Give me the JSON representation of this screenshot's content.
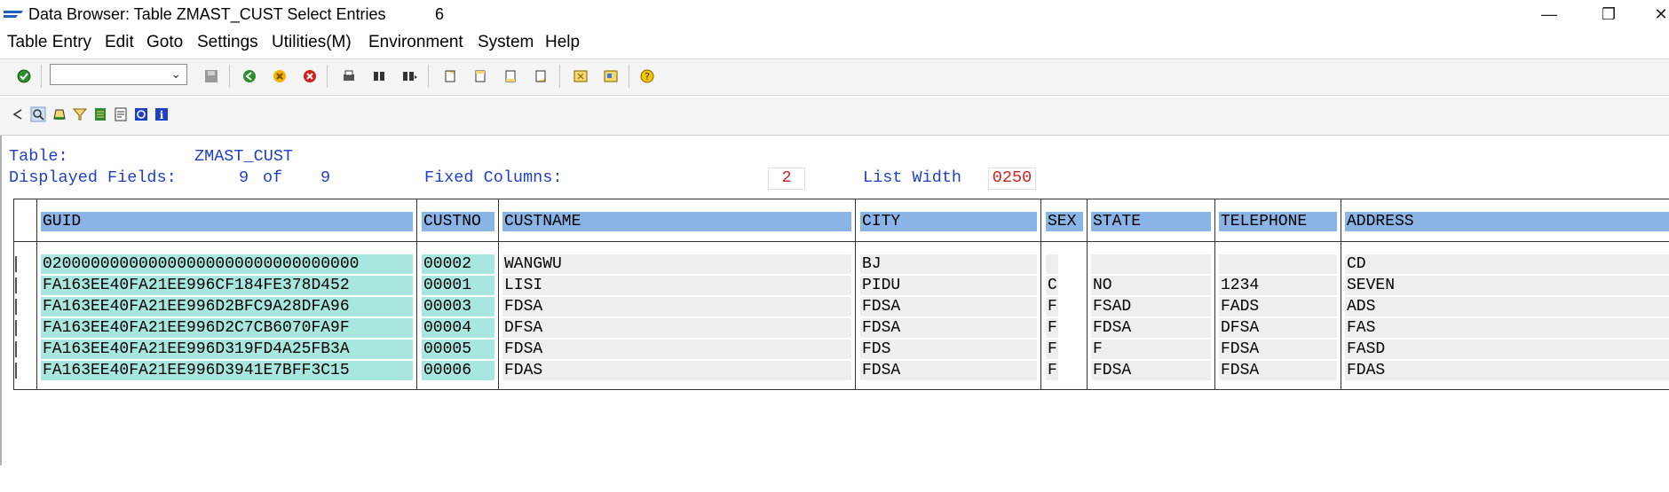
{
  "window": {
    "title": "Data Browser: Table ZMAST_CUST Select Entries",
    "count": "6",
    "minimize_icon": "minimize-icon",
    "restore_icon": "restore-icon",
    "close_icon": "close-icon"
  },
  "menu": [
    "Table Entry",
    "Edit",
    "Goto",
    "Settings",
    "Utilities(M)",
    "Environment",
    "System",
    "Help"
  ],
  "toolbar": {
    "command_value": "",
    "icons": [
      "enter-icon",
      "save-icon",
      "back-icon",
      "exit-icon",
      "cancel-icon",
      "print-icon",
      "find-icon",
      "find-next-icon",
      "first-page-icon",
      "previous-page-icon",
      "next-page-icon",
      "last-page-icon",
      "create-session-icon",
      "shortcut-icon",
      "help-icon"
    ],
    "app_icons": [
      "back-arrow-icon",
      "details-icon",
      "print-list-icon",
      "filter-icon",
      "spreadsheet-icon",
      "layout-icon",
      "refresh-icon",
      "info-icon"
    ]
  },
  "header": {
    "table_label": "Table:",
    "table_name": "ZMAST_CUST",
    "displayed_fields_label": "Displayed Fields:",
    "displayed_fields_value": "9",
    "of_label": "of",
    "total_fields": "9",
    "fixed_columns_label": "Fixed Columns:",
    "fixed_columns_value": "2",
    "list_width_label": "List Width",
    "list_width_value": "0250"
  },
  "table": {
    "columns": [
      "GUID",
      "CUSTNO",
      "CUSTNAME",
      "CITY",
      "SEX",
      "STATE",
      "TELEPHONE",
      "ADDRESS"
    ],
    "rows": [
      [
        "020000000000000000000000000000000",
        "00002",
        "WANGWU",
        "BJ",
        "",
        "",
        "",
        "CD"
      ],
      [
        "FA163EE40FA21EE996CF184FE378D452",
        "00001",
        "LISI",
        "PIDU",
        "C",
        "NO",
        "1234",
        "SEVEN"
      ],
      [
        "FA163EE40FA21EE996D2BFC9A28DFA96",
        "00003",
        "FDSA",
        "FDSA",
        "F",
        "FSAD",
        "FADS",
        "ADS"
      ],
      [
        "FA163EE40FA21EE996D2C7CB6070FA9F",
        "00004",
        "DFSA",
        "FDSA",
        "F",
        "FDSA",
        "DFSA",
        "FAS"
      ],
      [
        "FA163EE40FA21EE996D319FD4A25FB3A",
        "00005",
        "FDSA",
        "FDS",
        "F",
        "F",
        "FDSA",
        "FASD"
      ],
      [
        "FA163EE40FA21EE996D3941E7BFF3C15",
        "00006",
        "FDAS",
        "FDSA",
        "F",
        "FDSA",
        "FDSA",
        "FDAS"
      ]
    ]
  },
  "colors": {
    "header_bg": "#8ab4e6",
    "key_cell_bg": "#a8e6e0",
    "label_blue": "#1f3fc6",
    "value_red": "#d02020"
  }
}
